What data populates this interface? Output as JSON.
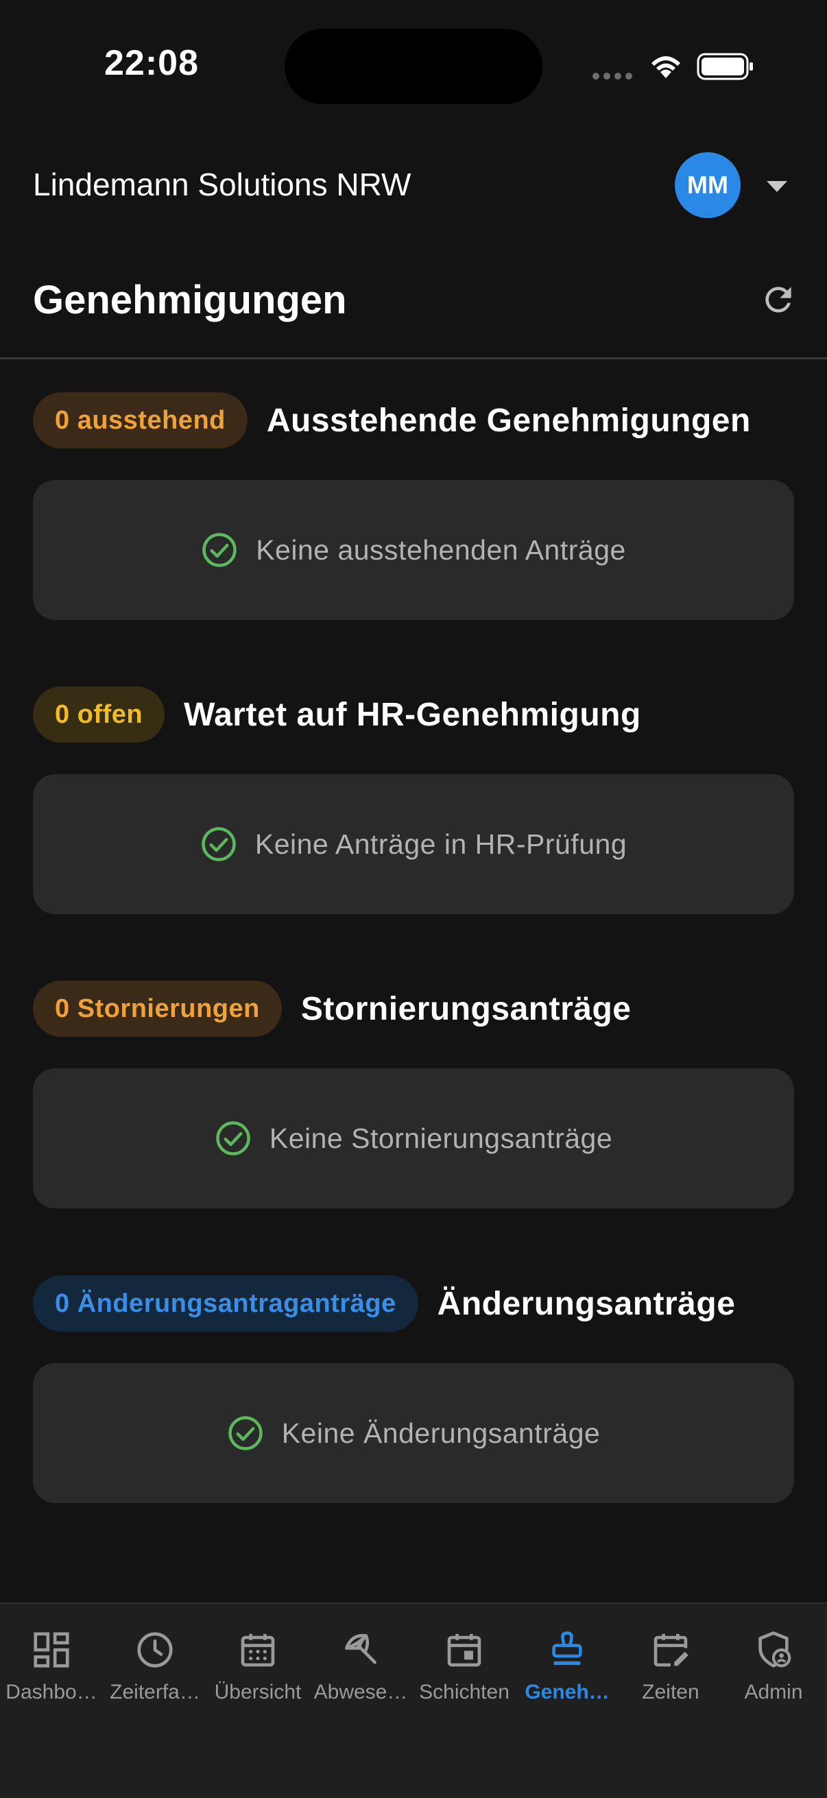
{
  "status_bar": {
    "time": "22:08"
  },
  "header": {
    "company": "Lindemann Solutions NRW",
    "avatar_initials": "MM"
  },
  "page": {
    "title": "Genehmigungen"
  },
  "sections": [
    {
      "badge": "0 ausstehend",
      "title": "Ausstehende Genehmigungen",
      "empty_text": "Keine ausstehenden Anträge",
      "badge_color": "#f0a23a"
    },
    {
      "badge": "0 offen",
      "title": "Wartet auf HR-Genehmigung",
      "empty_text": "Keine Anträge in HR-Prüfung",
      "badge_color": "#f2bb28"
    },
    {
      "badge": "0 Stornierungen",
      "title": "Stornierungsanträge",
      "empty_text": "Keine Stornierungsanträge",
      "badge_color": "#f0a23a"
    },
    {
      "badge": "0 Änderungsantraganträge",
      "title": "Änderungsanträge",
      "empty_text": "Keine Änderungsanträge",
      "badge_color": "#3a8ee6"
    }
  ],
  "nav": [
    {
      "label": "Dashbo…",
      "icon": "dashboard-icon"
    },
    {
      "label": "Zeiterfa…",
      "icon": "clock-icon"
    },
    {
      "label": "Übersicht",
      "icon": "calendar-grid-icon"
    },
    {
      "label": "Abwese…",
      "icon": "beach-umbrella-icon"
    },
    {
      "label": "Schichten",
      "icon": "calendar-event-icon"
    },
    {
      "label": "Geneh…",
      "icon": "stamp-icon",
      "active": true
    },
    {
      "label": "Zeiten",
      "icon": "calendar-edit-icon"
    },
    {
      "label": "Admin",
      "icon": "admin-shield-icon"
    }
  ],
  "colors": {
    "accent": "#2a88e6",
    "success": "#5cb85c",
    "background": "#131313",
    "card": "#2a2a2a"
  }
}
